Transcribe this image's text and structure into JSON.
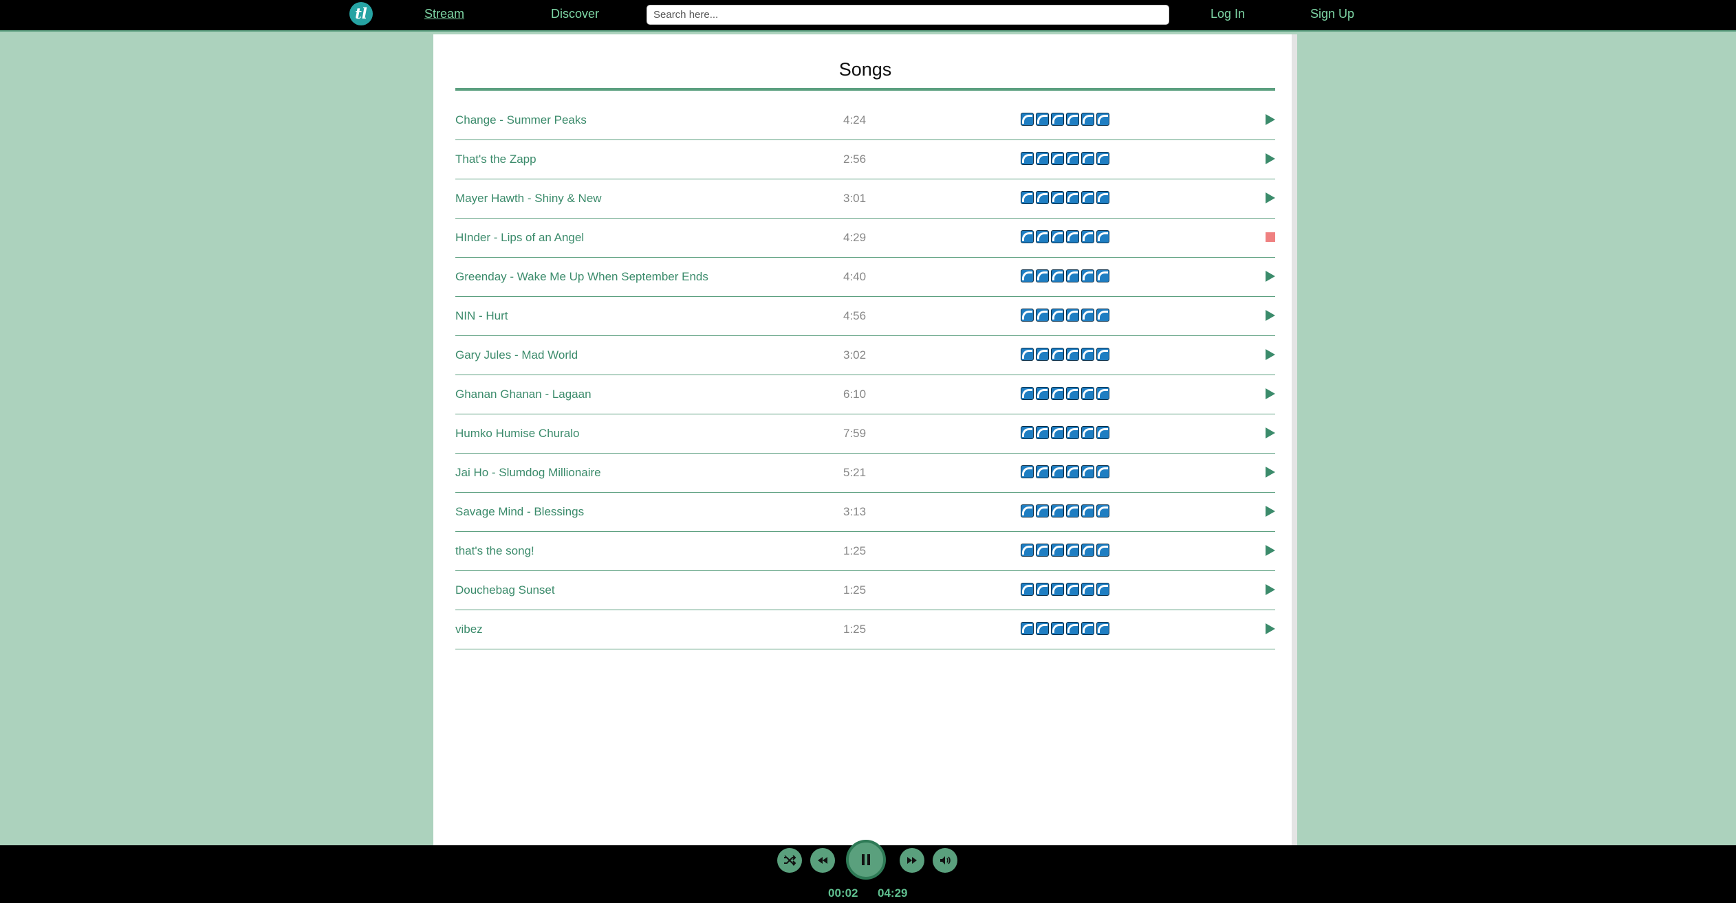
{
  "nav": {
    "logo_text": "tl",
    "stream": "Stream",
    "discover": "Discover",
    "search_placeholder": "Search here...",
    "login": "Log In",
    "signup": "Sign Up"
  },
  "page": {
    "title": "Songs"
  },
  "songs": [
    {
      "title": "Change - Summer Peaks",
      "duration": "4:24",
      "rating": 6,
      "state": "play"
    },
    {
      "title": "That's the Zapp",
      "duration": "2:56",
      "rating": 6,
      "state": "play"
    },
    {
      "title": "Mayer Hawth - Shiny & New",
      "duration": "3:01",
      "rating": 6,
      "state": "play"
    },
    {
      "title": "HInder - Lips of an Angel",
      "duration": "4:29",
      "rating": 6,
      "state": "stop"
    },
    {
      "title": "Greenday - Wake Me Up When September Ends",
      "duration": "4:40",
      "rating": 6,
      "state": "play"
    },
    {
      "title": "NIN - Hurt",
      "duration": "4:56",
      "rating": 6,
      "state": "play"
    },
    {
      "title": "Gary Jules - Mad World",
      "duration": "3:02",
      "rating": 6,
      "state": "play"
    },
    {
      "title": "Ghanan Ghanan - Lagaan",
      "duration": "6:10",
      "rating": 6,
      "state": "play"
    },
    {
      "title": "Humko Humise Churalo",
      "duration": "7:59",
      "rating": 6,
      "state": "play"
    },
    {
      "title": "Jai Ho - Slumdog Millionaire",
      "duration": "5:21",
      "rating": 6,
      "state": "play"
    },
    {
      "title": "Savage Mind - Blessings",
      "duration": "3:13",
      "rating": 6,
      "state": "play"
    },
    {
      "title": "that's the song!",
      "duration": "1:25",
      "rating": 6,
      "state": "play"
    },
    {
      "title": "Douchebag Sunset",
      "duration": "1:25",
      "rating": 6,
      "state": "play"
    },
    {
      "title": "vibez",
      "duration": "1:25",
      "rating": 6,
      "state": "play"
    }
  ],
  "player": {
    "elapsed": "00:02",
    "total": "04:29",
    "is_playing": true
  },
  "colors": {
    "accent": "#5b9f7f",
    "background": "#acd2bd",
    "link": "#3b8b6b",
    "stop": "#ef8080"
  }
}
